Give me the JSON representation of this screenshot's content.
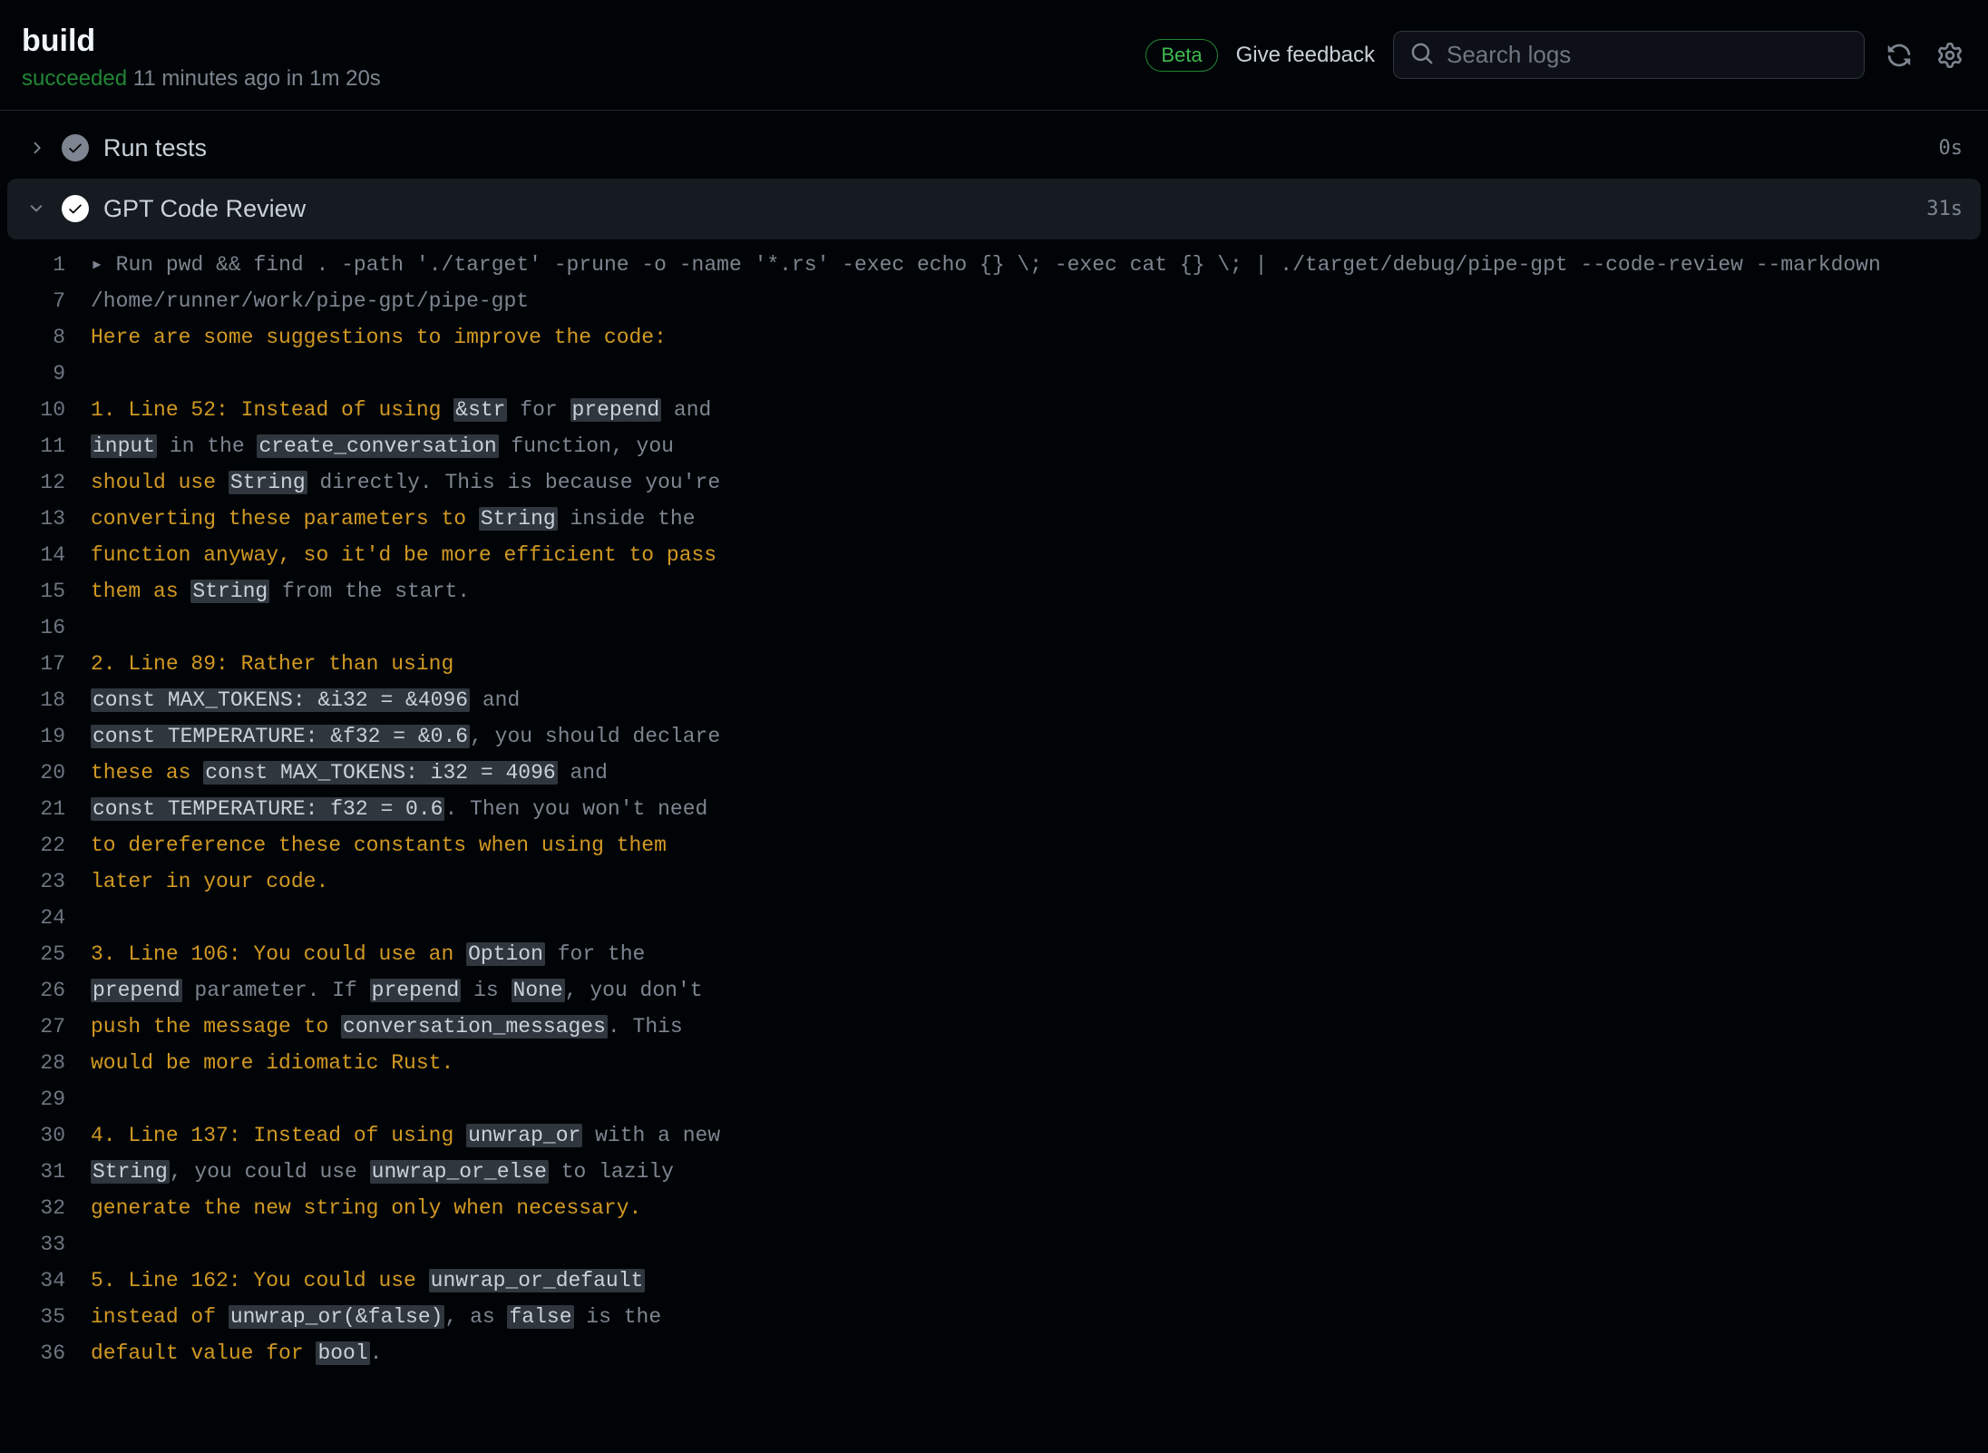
{
  "header": {
    "title": "build",
    "status_word": "succeeded",
    "status_rest": " 11 minutes ago in 1m 20s",
    "beta_label": "Beta",
    "feedback_label": "Give feedback",
    "search_placeholder": "Search logs"
  },
  "steps": [
    {
      "title": "Run tests",
      "time": "0s",
      "expanded": false,
      "success": false
    },
    {
      "title": "GPT Code Review",
      "time": "31s",
      "expanded": true,
      "success": true
    }
  ],
  "log": [
    {
      "n": 1,
      "kind": "cmd",
      "spans": [
        {
          "t": "▸ ",
          "c": "dim"
        },
        {
          "t": "Run pwd && find . -path './target' -prune -o -name '*.rs' -exec echo {} \\; -exec cat {} \\; | ./target/debug/pipe-gpt --code-review --markdown",
          "c": "dim"
        }
      ]
    },
    {
      "n": 7,
      "spans": [
        {
          "t": "/home/runner/work/pipe-gpt/pipe-gpt",
          "c": "dim"
        }
      ]
    },
    {
      "n": 8,
      "spans": [
        {
          "t": "Here are some suggestions to improve the code:",
          "c": "hl"
        }
      ]
    },
    {
      "n": 9,
      "spans": []
    },
    {
      "n": 10,
      "spans": [
        {
          "t": "1. Line 52: Instead of using ",
          "c": "hl"
        },
        {
          "t": "&str",
          "c": "code"
        },
        {
          "t": " for ",
          "c": "dim"
        },
        {
          "t": "prepend",
          "c": "code"
        },
        {
          "t": " and",
          "c": "dim"
        }
      ]
    },
    {
      "n": 11,
      "spans": [
        {
          "t": "input",
          "c": "code"
        },
        {
          "t": " in the ",
          "c": "dim"
        },
        {
          "t": "create_conversation",
          "c": "code"
        },
        {
          "t": " function, you",
          "c": "dim"
        }
      ]
    },
    {
      "n": 12,
      "spans": [
        {
          "t": "should use ",
          "c": "hl"
        },
        {
          "t": "String",
          "c": "code"
        },
        {
          "t": " directly. This is because you're",
          "c": "dim"
        }
      ]
    },
    {
      "n": 13,
      "spans": [
        {
          "t": "converting these parameters to ",
          "c": "hl"
        },
        {
          "t": "String",
          "c": "code"
        },
        {
          "t": " inside the",
          "c": "dim"
        }
      ]
    },
    {
      "n": 14,
      "spans": [
        {
          "t": "function anyway, so it'd be more efficient to pass",
          "c": "hl"
        }
      ]
    },
    {
      "n": 15,
      "spans": [
        {
          "t": "them as ",
          "c": "hl"
        },
        {
          "t": "String",
          "c": "code"
        },
        {
          "t": " from the start.",
          "c": "dim"
        }
      ]
    },
    {
      "n": 16,
      "spans": []
    },
    {
      "n": 17,
      "spans": [
        {
          "t": "2. Line 89: Rather than using",
          "c": "hl"
        }
      ]
    },
    {
      "n": 18,
      "spans": [
        {
          "t": "const MAX_TOKENS: &i32 = &4096",
          "c": "code"
        },
        {
          "t": " and",
          "c": "dim"
        }
      ]
    },
    {
      "n": 19,
      "spans": [
        {
          "t": "const TEMPERATURE: &f32 = &0.6",
          "c": "code"
        },
        {
          "t": ", you should declare",
          "c": "dim"
        }
      ]
    },
    {
      "n": 20,
      "spans": [
        {
          "t": "these as ",
          "c": "hl"
        },
        {
          "t": "const MAX_TOKENS: i32 = 4096",
          "c": "code"
        },
        {
          "t": " and",
          "c": "dim"
        }
      ]
    },
    {
      "n": 21,
      "spans": [
        {
          "t": "const TEMPERATURE: f32 = 0.6",
          "c": "code"
        },
        {
          "t": ". Then you won't need",
          "c": "dim"
        }
      ]
    },
    {
      "n": 22,
      "spans": [
        {
          "t": "to dereference these constants when using them",
          "c": "hl"
        }
      ]
    },
    {
      "n": 23,
      "spans": [
        {
          "t": "later in your code.",
          "c": "hl"
        }
      ]
    },
    {
      "n": 24,
      "spans": []
    },
    {
      "n": 25,
      "spans": [
        {
          "t": "3. Line 106: You could use an ",
          "c": "hl"
        },
        {
          "t": "Option",
          "c": "code"
        },
        {
          "t": " for the",
          "c": "dim"
        }
      ]
    },
    {
      "n": 26,
      "spans": [
        {
          "t": "prepend",
          "c": "code"
        },
        {
          "t": " parameter. If ",
          "c": "dim"
        },
        {
          "t": "prepend",
          "c": "code"
        },
        {
          "t": " is ",
          "c": "dim"
        },
        {
          "t": "None",
          "c": "code"
        },
        {
          "t": ", you don't",
          "c": "dim"
        }
      ]
    },
    {
      "n": 27,
      "spans": [
        {
          "t": "push the message to ",
          "c": "hl"
        },
        {
          "t": "conversation_messages",
          "c": "code"
        },
        {
          "t": ". This",
          "c": "dim"
        }
      ]
    },
    {
      "n": 28,
      "spans": [
        {
          "t": "would be more idiomatic Rust.",
          "c": "hl"
        }
      ]
    },
    {
      "n": 29,
      "spans": []
    },
    {
      "n": 30,
      "spans": [
        {
          "t": "4. Line 137: Instead of using ",
          "c": "hl"
        },
        {
          "t": "unwrap_or",
          "c": "code"
        },
        {
          "t": " with a new",
          "c": "dim"
        }
      ]
    },
    {
      "n": 31,
      "spans": [
        {
          "t": "String",
          "c": "code"
        },
        {
          "t": ", you could use ",
          "c": "dim"
        },
        {
          "t": "unwrap_or_else",
          "c": "code"
        },
        {
          "t": " to lazily",
          "c": "dim"
        }
      ]
    },
    {
      "n": 32,
      "spans": [
        {
          "t": "generate the new string only when necessary.",
          "c": "hl"
        }
      ]
    },
    {
      "n": 33,
      "spans": []
    },
    {
      "n": 34,
      "spans": [
        {
          "t": "5. Line 162: You could use ",
          "c": "hl"
        },
        {
          "t": "unwrap_or_default",
          "c": "code"
        }
      ]
    },
    {
      "n": 35,
      "spans": [
        {
          "t": "instead of ",
          "c": "hl"
        },
        {
          "t": "unwrap_or(&false)",
          "c": "code"
        },
        {
          "t": ", as ",
          "c": "dim"
        },
        {
          "t": "false",
          "c": "code"
        },
        {
          "t": " is the",
          "c": "dim"
        }
      ]
    },
    {
      "n": 36,
      "spans": [
        {
          "t": "default value for ",
          "c": "hl"
        },
        {
          "t": "bool",
          "c": "code"
        },
        {
          "t": ".",
          "c": "dim"
        }
      ]
    }
  ]
}
